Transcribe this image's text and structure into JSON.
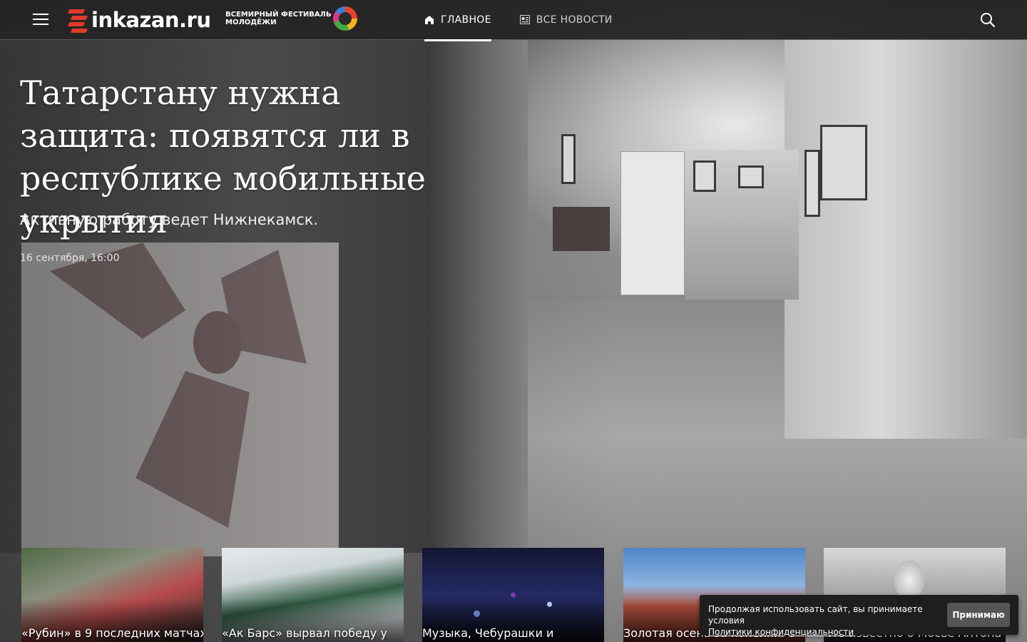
{
  "header": {
    "logo_text": "inkazan.ru",
    "festival_line1": "ВСЕМИРНЫЙ ФЕСТИВАЛЬ",
    "festival_line2": "МОЛОДЁЖИ",
    "nav": [
      {
        "label": "ГЛАВНОЕ",
        "icon": "home-icon",
        "active": true
      },
      {
        "label": "ВСЕ НОВОСТИ",
        "icon": "newspaper-icon",
        "active": false
      }
    ],
    "menu_icon": "hamburger-icon",
    "search_icon": "search-icon"
  },
  "hero": {
    "title": "Татарстану нужна защита: появятся ли в республике мобильные укрытия",
    "lead": "Активную работу ведет Нижнекамск.",
    "date": "16 сентября, 16:00"
  },
  "cards": [
    {
      "title": "«Рубин» в 9 последних матчах"
    },
    {
      "title": "«Ак Барс» вырвал победу у"
    },
    {
      "title": "Музыка, Чебурашки и"
    },
    {
      "title": "Золотая осень за копейки: 5"
    },
    {
      "title": "Что известно о Мосье Антона"
    }
  ],
  "cookie": {
    "text": "Продолжая использовать сайт, вы принимаете условия",
    "link": "Политики конфиденциальности",
    "button": "Принимаю"
  },
  "colors": {
    "header_bg": "#222222",
    "logo_accent": "#e03a2a",
    "cookie_bg": "#1e1e1e",
    "cookie_button": "#555555"
  }
}
